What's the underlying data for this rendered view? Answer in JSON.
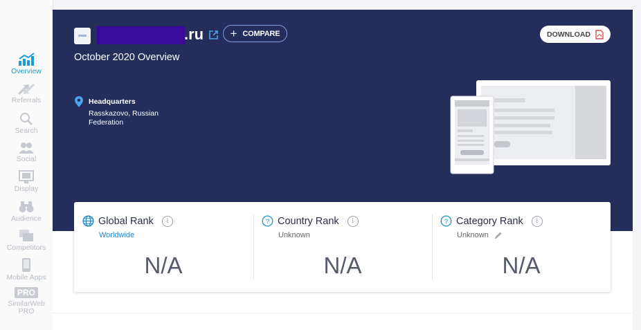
{
  "sidebar": {
    "items": [
      {
        "label": "Overview",
        "icon": "bar-chart-icon",
        "active": true
      },
      {
        "label": "Referrals",
        "icon": "arrows-icon"
      },
      {
        "label": "Search",
        "icon": "magnifier-icon"
      },
      {
        "label": "Social",
        "icon": "people-icon"
      },
      {
        "label": "Display",
        "icon": "display-ad-icon"
      },
      {
        "label": "Audience",
        "icon": "binoculars-icon"
      },
      {
        "label": "Competitors",
        "icon": "competitors-icon"
      },
      {
        "label": "Mobile Apps",
        "icon": "mobile-phone-icon"
      },
      {
        "label": "SimilarWeb PRO",
        "badge": "PRO",
        "icon": "pro-badge-icon"
      }
    ]
  },
  "header": {
    "domain_tld": ".ru",
    "compare_label": "COMPARE",
    "download_label": "DOWNLOAD",
    "overview_title": "October 2020 Overview",
    "hq_label": "Headquarters",
    "hq_value": "Rasskazovo, Russian Federation"
  },
  "ranks": [
    {
      "title": "Global Rank",
      "sub": "Worldwide",
      "value": "N/A",
      "icon": "globe-icon"
    },
    {
      "title": "Country Rank",
      "sub": "Unknown",
      "value": "N/A",
      "icon": "question-circle-icon"
    },
    {
      "title": "Category Rank",
      "sub": "Unknown",
      "value": "N/A",
      "icon": "question-circle-icon"
    }
  ],
  "colors": {
    "hero_bg": "#252e5b",
    "accent": "#1e9cd7",
    "redaction": "#3a0a9a"
  }
}
